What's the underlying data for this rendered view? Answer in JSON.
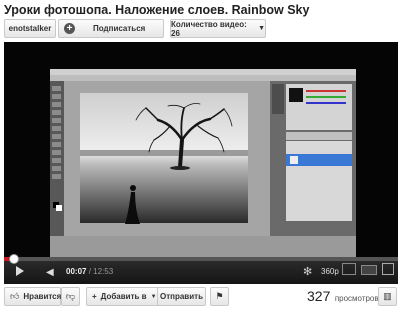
{
  "video": {
    "title": "Уроки фотошопа. Наложение слоев. Rainbow Sky"
  },
  "channel": {
    "name": "enotstalker",
    "subscribe_label": "Подписаться",
    "video_count_label": "Количество видео: 26"
  },
  "player": {
    "current_time": "00:07",
    "duration": "12:53",
    "time_separator": "/",
    "quality": "360p",
    "progress_fraction": 0.009
  },
  "actions": {
    "like_label": "Нравится",
    "add_label": "Добавить в",
    "share_label": "Отправить"
  },
  "stats": {
    "views_count": "327",
    "views_label": "просмотров"
  },
  "icons": [
    "plus-icon",
    "chevron-down-icon",
    "play-icon",
    "volume-icon",
    "settings-icon",
    "thumbs-up-icon",
    "thumbs-down-icon",
    "flag-icon",
    "stats-icon"
  ],
  "colors": {
    "progress": "#cc181e",
    "player_bg": "#000000",
    "ps_panel_blue": "#3a78d6"
  }
}
